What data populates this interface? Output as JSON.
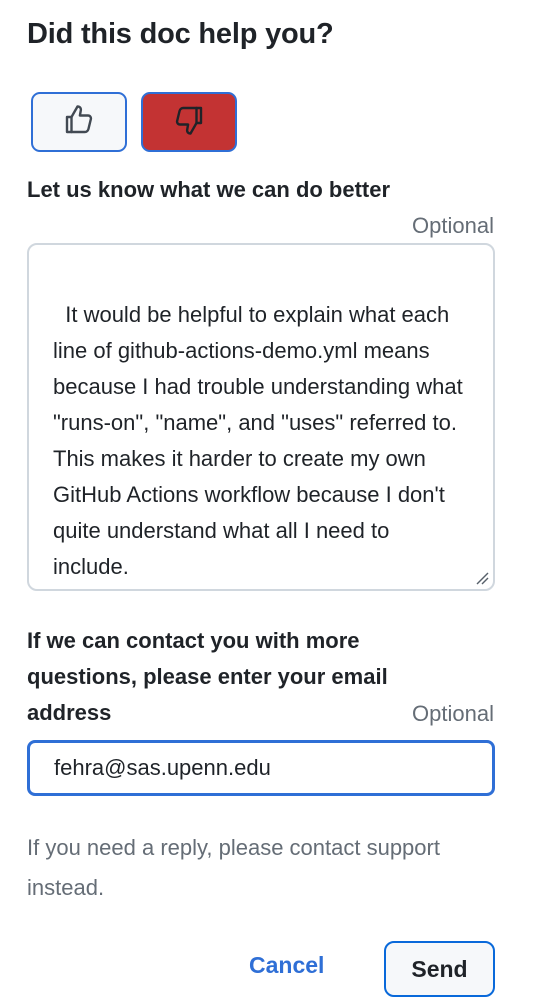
{
  "title": "Did this doc help you?",
  "votes": {
    "up_icon": "thumbs-up-icon",
    "down_icon": "thumbs-down-icon",
    "down_selected_color": "#c33333",
    "focus_color": "#2f6fd6"
  },
  "feedback": {
    "label": "Let us know what we can do better",
    "optional": "Optional",
    "value": "It would be helpful to explain what each line of github-actions-demo.yml means because I had trouble understanding what \"runs-on\", \"name\", and \"uses\" referred to. This makes it harder to create my own GitHub Actions workflow because I don't quite understand what all I need to include."
  },
  "contact": {
    "label": "If we can contact you with more questions, please enter your email address",
    "optional": "Optional",
    "email_value": "fehra@sas.upenn.edu"
  },
  "note": "If you need a reply, please contact support instead.",
  "actions": {
    "cancel_label": "Cancel",
    "send_label": "Send"
  }
}
